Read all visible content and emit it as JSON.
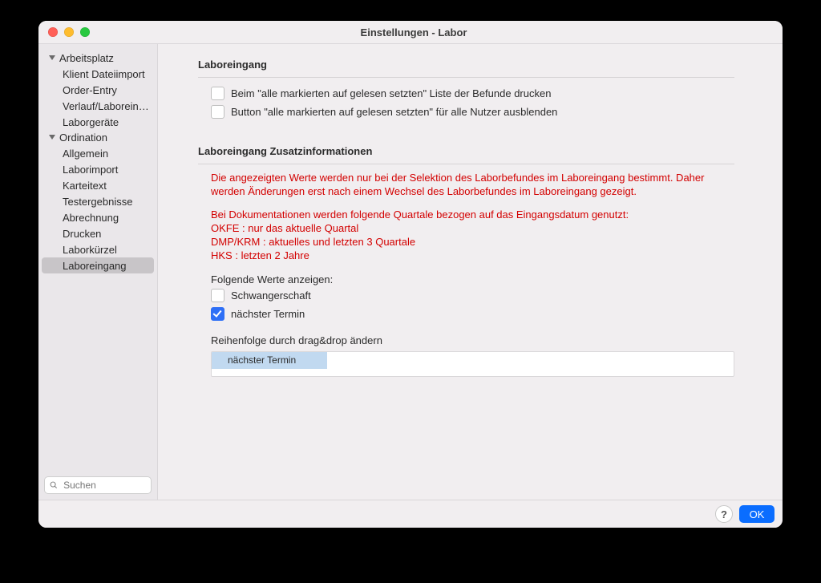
{
  "window_title": "Einstellungen - Labor",
  "sidebar": {
    "groups": [
      {
        "label": "Arbeitsplatz",
        "items": [
          "Klient Dateiimport",
          "Order-Entry",
          "Verlauf/Laboreing…",
          "Laborgeräte"
        ]
      },
      {
        "label": "Ordination",
        "items": [
          "Allgemein",
          "Laborimport",
          "Karteitext",
          "Testergebnisse",
          "Abrechnung",
          "Drucken",
          "Laborkürzel",
          "Laboreingang"
        ]
      }
    ],
    "selected": "Laboreingang",
    "search_placeholder": "Suchen"
  },
  "section1": {
    "title": "Laboreingang",
    "opt1": "Beim \"alle markierten auf gelesen setzten\" Liste der Befunde drucken",
    "opt2": "Button \"alle markierten auf gelesen setzten\" für alle Nutzer ausblenden"
  },
  "section2": {
    "title": "Laboreingang Zusatzinformationen",
    "notice_line1": "Die angezeigten Werte werden nur bei der Selektion des Laborbefundes im Laboreingang bestimmt. Daher werden Änderungen erst nach einem Wechsel des Laborbefundes im Laboreingang gezeigt.",
    "notice_block2_l1": "Bei Dokumentationen werden folgende Quartale bezogen auf das Eingangsdatum genutzt:",
    "notice_block2_l2": "OKFE : nur das aktuelle Quartal",
    "notice_block2_l3": "DMP/KRM : aktuelles und letzten 3 Quartale",
    "notice_block2_l4": "HKS : letzten 2 Jahre",
    "values_label": "Folgende Werte anzeigen:",
    "val1": "Schwangerschaft",
    "val2": "nächster Termin",
    "reorder_label": "Reihenfolge durch drag&drop ändern",
    "drag_item": "nächster Termin"
  },
  "footer": {
    "help_label": "?",
    "ok_label": "OK"
  }
}
